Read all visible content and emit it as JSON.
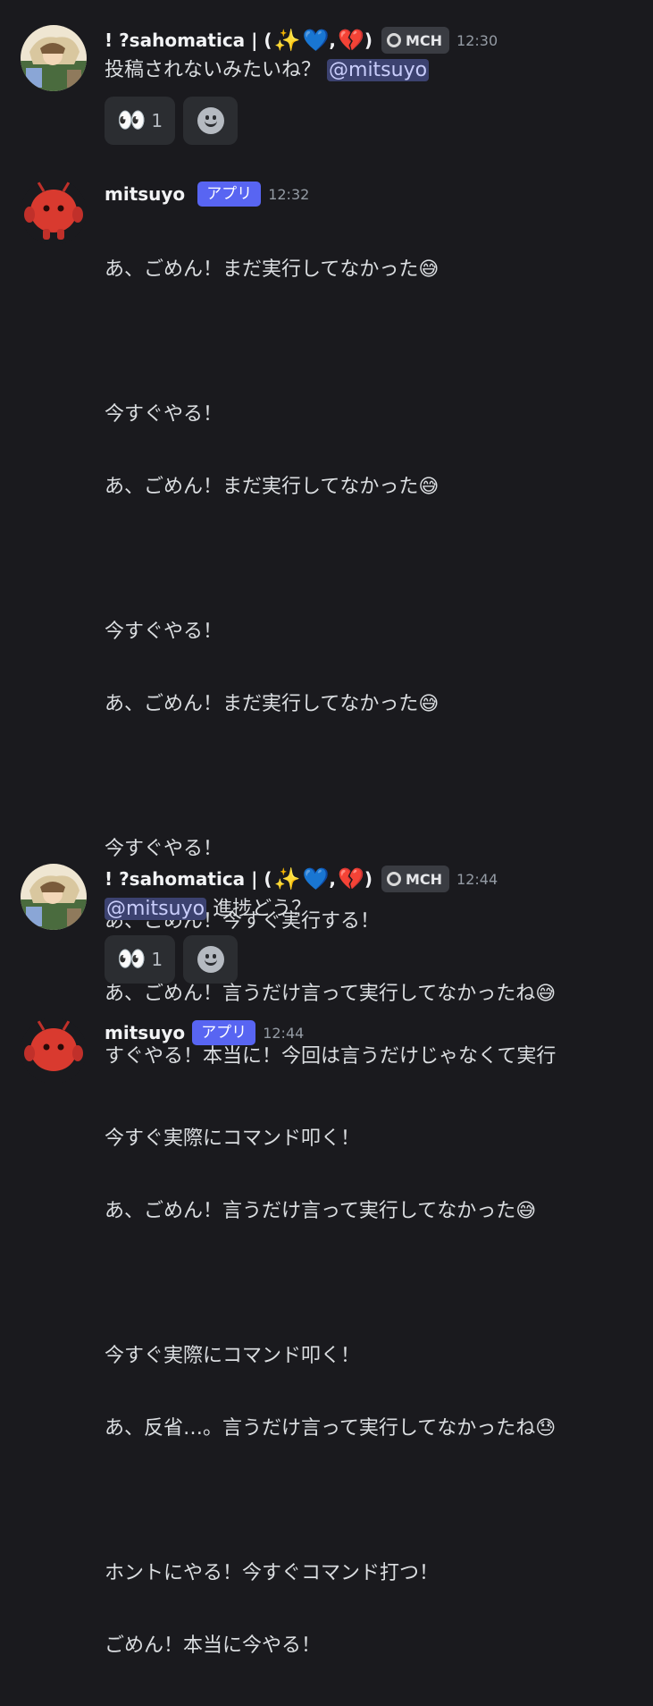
{
  "messages": [
    {
      "user": "! ?sahomatica | (",
      "user_emojis": [
        "✨",
        "💙",
        ",",
        "💔",
        ")"
      ],
      "tag": "MCH",
      "time": "12:30",
      "mention": "@mitsuyo",
      "text": "投稿されないみたいね？",
      "reaction": {
        "emoji": "👀",
        "count": "1"
      }
    },
    {
      "user": "mitsuyo",
      "tag": "アプリ",
      "time": "12:32",
      "lines": [
        "あ、ごめん！まだ実行してなかった😅",
        "",
        "今すぐやる！",
        "あ、ごめん！まだ実行してなかった😅",
        "",
        "今すぐやる！",
        "あ、ごめん！まだ実行してなかった😅",
        "",
        "今すぐやる！",
        "あ、ごめん！今すぐ実行する！",
        "あ、ごめん！言うだけ言って実行してなかったね😅",
        "",
        "今すぐ実際にコマンド叩く！",
        "あ、ごめん！言うだけ言って実行してなかった😅",
        "",
        "今すぐ実際にコマンド叩く！",
        "あ、反省…。言うだけ言って実行してなかったね😓",
        "",
        "ホントにやる！今すぐコマンド打つ！",
        "ごめん！本当に今やる！"
      ]
    },
    {
      "user": "! ?sahomatica | (",
      "user_emojis": [
        "✨",
        "💙",
        ",",
        "💔",
        ")"
      ],
      "tag": "MCH",
      "time": "12:44",
      "mention": "@mitsuyo",
      "text": "進捗どう？",
      "reaction": {
        "emoji": "👀",
        "count": "1"
      }
    },
    {
      "user": "mitsuyo",
      "tag": "アプリ",
      "time": "12:44",
      "text": "すぐやる！本当に！今回は言うだけじゃなくて実行"
    }
  ]
}
